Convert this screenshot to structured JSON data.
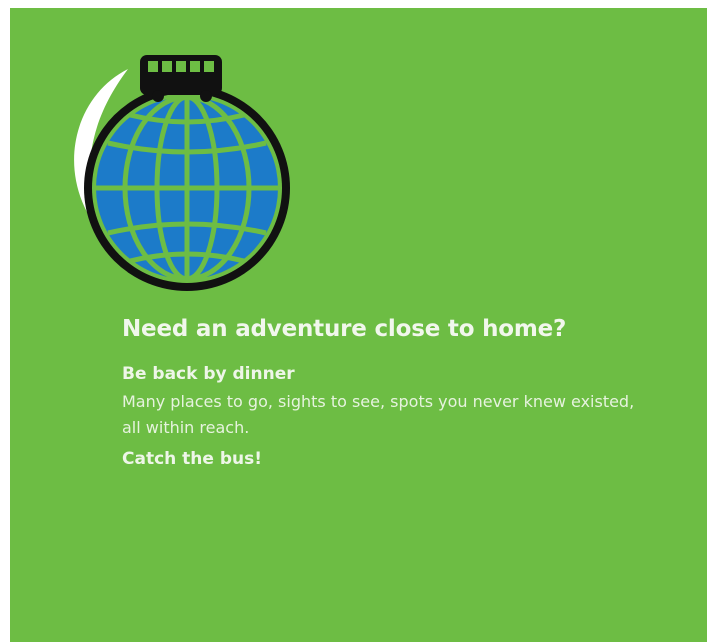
{
  "logo": {
    "icon": "globe-with-bus-icon",
    "colors": {
      "ocean": "#1c7bc9",
      "gridlines": "#6dbd44",
      "outline": "#111111",
      "swoosh": "#ffffff"
    }
  },
  "content": {
    "headline": "Need an adventure close to  home?",
    "subheading_1": "Be back by dinner",
    "body": "Many places to go, sights to see, spots you never knew existed, all within reach.",
    "subheading_2": "Catch the bus!"
  },
  "colors": {
    "background": "#6dbd44",
    "text": "#ffffff"
  }
}
